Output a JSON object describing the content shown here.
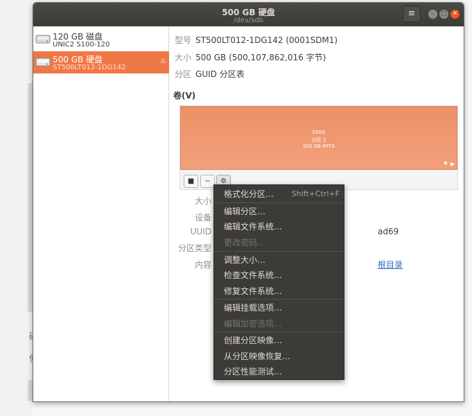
{
  "window": {
    "title": "500 GB 硬盘",
    "subtitle": "/dev/sdb"
  },
  "titlebar": {
    "menu_icon": "≡",
    "min_icon": "–",
    "max_icon": "□",
    "close_icon": "✕"
  },
  "sidebar": {
    "drives": [
      {
        "name": "120 GB 磁盘",
        "model": "UNIC2 S100-120"
      },
      {
        "name": "500 GB 硬盘",
        "model": "ST500LT012-1DG142",
        "selected": true
      }
    ]
  },
  "disk_info": {
    "model_label": "型号",
    "model_value": "ST500LT012-1DG142 (0001SDM1)",
    "size_label": "大小",
    "size_value": "500 GB (500,107,862,016 字节)",
    "partitioning_label": "分区",
    "partitioning_value": "GUID 分区表"
  },
  "volumes": {
    "heading": "卷(V)",
    "partition": {
      "line1": "500G",
      "line2": "分区 1",
      "line3": "500 GB NTFS",
      "star": "★",
      "play": "▶"
    },
    "buttons": {
      "stop": "■",
      "remove": "−",
      "settings": "⚙"
    }
  },
  "details": {
    "size_label": "大小",
    "device_label": "设备",
    "uuid_label": "UUID",
    "uuid_value_suffix": "ad69",
    "partition_type_label": "分区类型",
    "contents_label": "内容",
    "contents_link_suffix": "根目录"
  },
  "context_menu": {
    "items": [
      {
        "label": "格式化分区…",
        "accel": "Shift+Ctrl+F",
        "enabled": true
      },
      {
        "label": "编辑分区…",
        "enabled": true
      },
      {
        "label": "编辑文件系统…",
        "enabled": true
      },
      {
        "label": "更改密码…",
        "enabled": false
      },
      {
        "label": "调整大小…",
        "enabled": true
      },
      {
        "label": "检查文件系统…",
        "enabled": true
      },
      {
        "label": "修复文件系统…",
        "enabled": true
      },
      {
        "label": "编辑挂载选项…",
        "enabled": true
      },
      {
        "label": "编辑加密选项…",
        "enabled": false
      },
      {
        "label": "创建分区映像…",
        "enabled": true
      },
      {
        "label": "从分区映像恢复…",
        "enabled": true
      },
      {
        "label": "分区性能测试…",
        "enabled": true
      }
    ]
  },
  "background": {
    "letter1": "磁",
    "letter2": "使"
  },
  "colors": {
    "accent": "#f07746",
    "partition_fill": "#ef9a73",
    "titlebar": "#3c3b37",
    "menu_bg": "#3c3b37"
  }
}
